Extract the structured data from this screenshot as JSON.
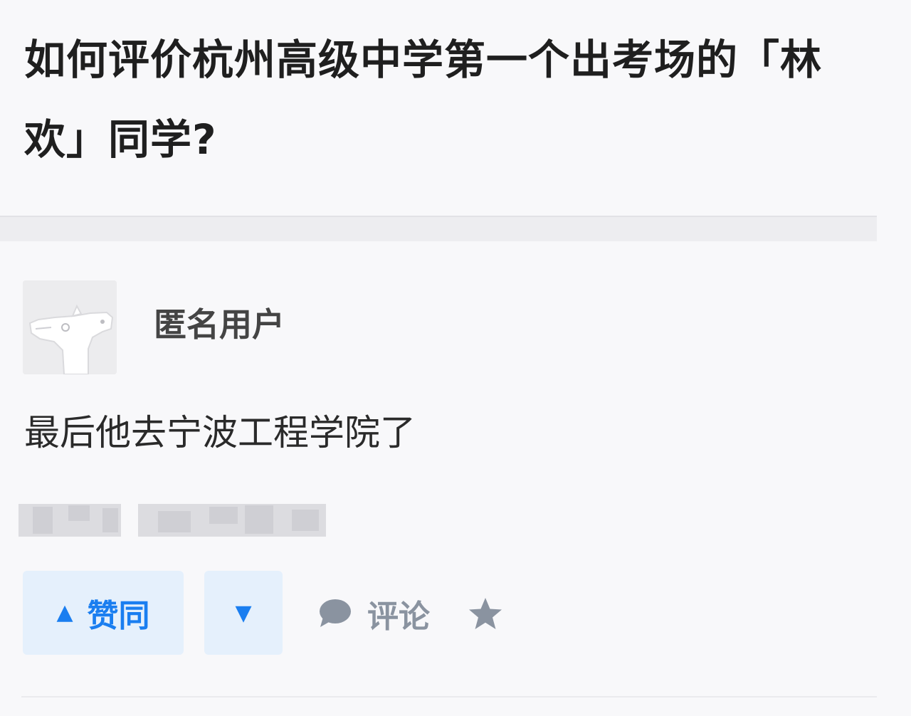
{
  "question": {
    "title": "如何评价杭州高级中学第一个出考场的「林欢」同学?"
  },
  "answer": {
    "author_name": "匿名用户",
    "content": "最后他去宁波工程学院了"
  },
  "actions": {
    "upvote_icon": "▲",
    "upvote_label": "赞同",
    "downvote_icon": "▼",
    "comment_label": "评论",
    "accent_color": "#1a7ef0",
    "muted_color": "#8a93a0"
  }
}
